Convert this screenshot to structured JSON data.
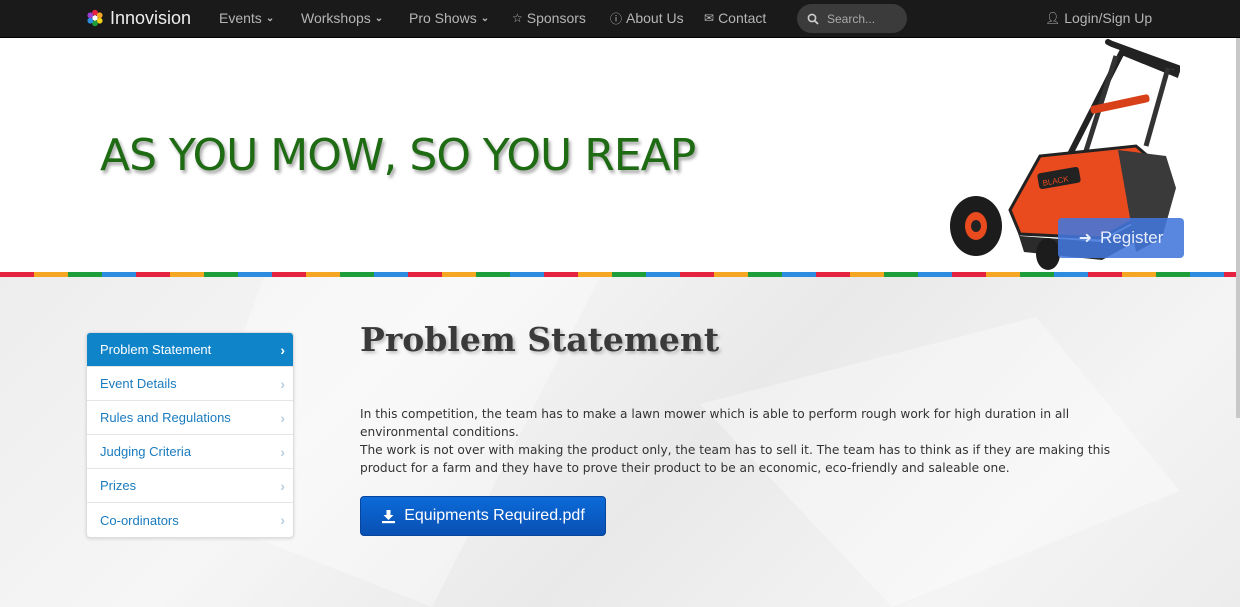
{
  "nav": {
    "brand": "Innovision",
    "items": [
      {
        "label": "Events",
        "icon": "",
        "dropdown": true
      },
      {
        "label": "Workshops",
        "icon": "",
        "dropdown": true
      },
      {
        "label": "Pro Shows",
        "icon": "",
        "dropdown": true
      },
      {
        "label": "Sponsors",
        "icon": "star-icon",
        "dropdown": false
      },
      {
        "label": "About Us",
        "icon": "info-icon",
        "dropdown": false
      },
      {
        "label": "Contact",
        "icon": "envelope-icon",
        "dropdown": false
      }
    ],
    "search_placeholder": "Search...",
    "login_label": "Login/Sign Up"
  },
  "hero": {
    "title": "AS YOU MOW, SO YOU REAP",
    "register_label": "Register",
    "title_color": "#1e6b14"
  },
  "sidebar": {
    "items": [
      {
        "label": "Problem Statement",
        "active": true
      },
      {
        "label": "Event Details",
        "active": false
      },
      {
        "label": "Rules and Regulations",
        "active": false
      },
      {
        "label": "Judging Criteria",
        "active": false
      },
      {
        "label": "Prizes",
        "active": false
      },
      {
        "label": "Co-ordinators",
        "active": false
      }
    ]
  },
  "content": {
    "title": "Problem Statement",
    "paragraph1": "In this competition, the team has to make a lawn mower which is able to perform rough work for high duration in all environmental conditions.",
    "paragraph2": "The work is not over with making the product only, the team has to sell it. The team has to think as if they are making this product for a farm and they have to prove their product to be an economic, eco-friendly and saleable one.",
    "download_label": "Equipments Required.pdf"
  },
  "colors": {
    "accent": "#0f84c9",
    "stripe": [
      "#e5223f",
      "#f5a623",
      "#1e9e3a",
      "#2c8de0"
    ]
  }
}
